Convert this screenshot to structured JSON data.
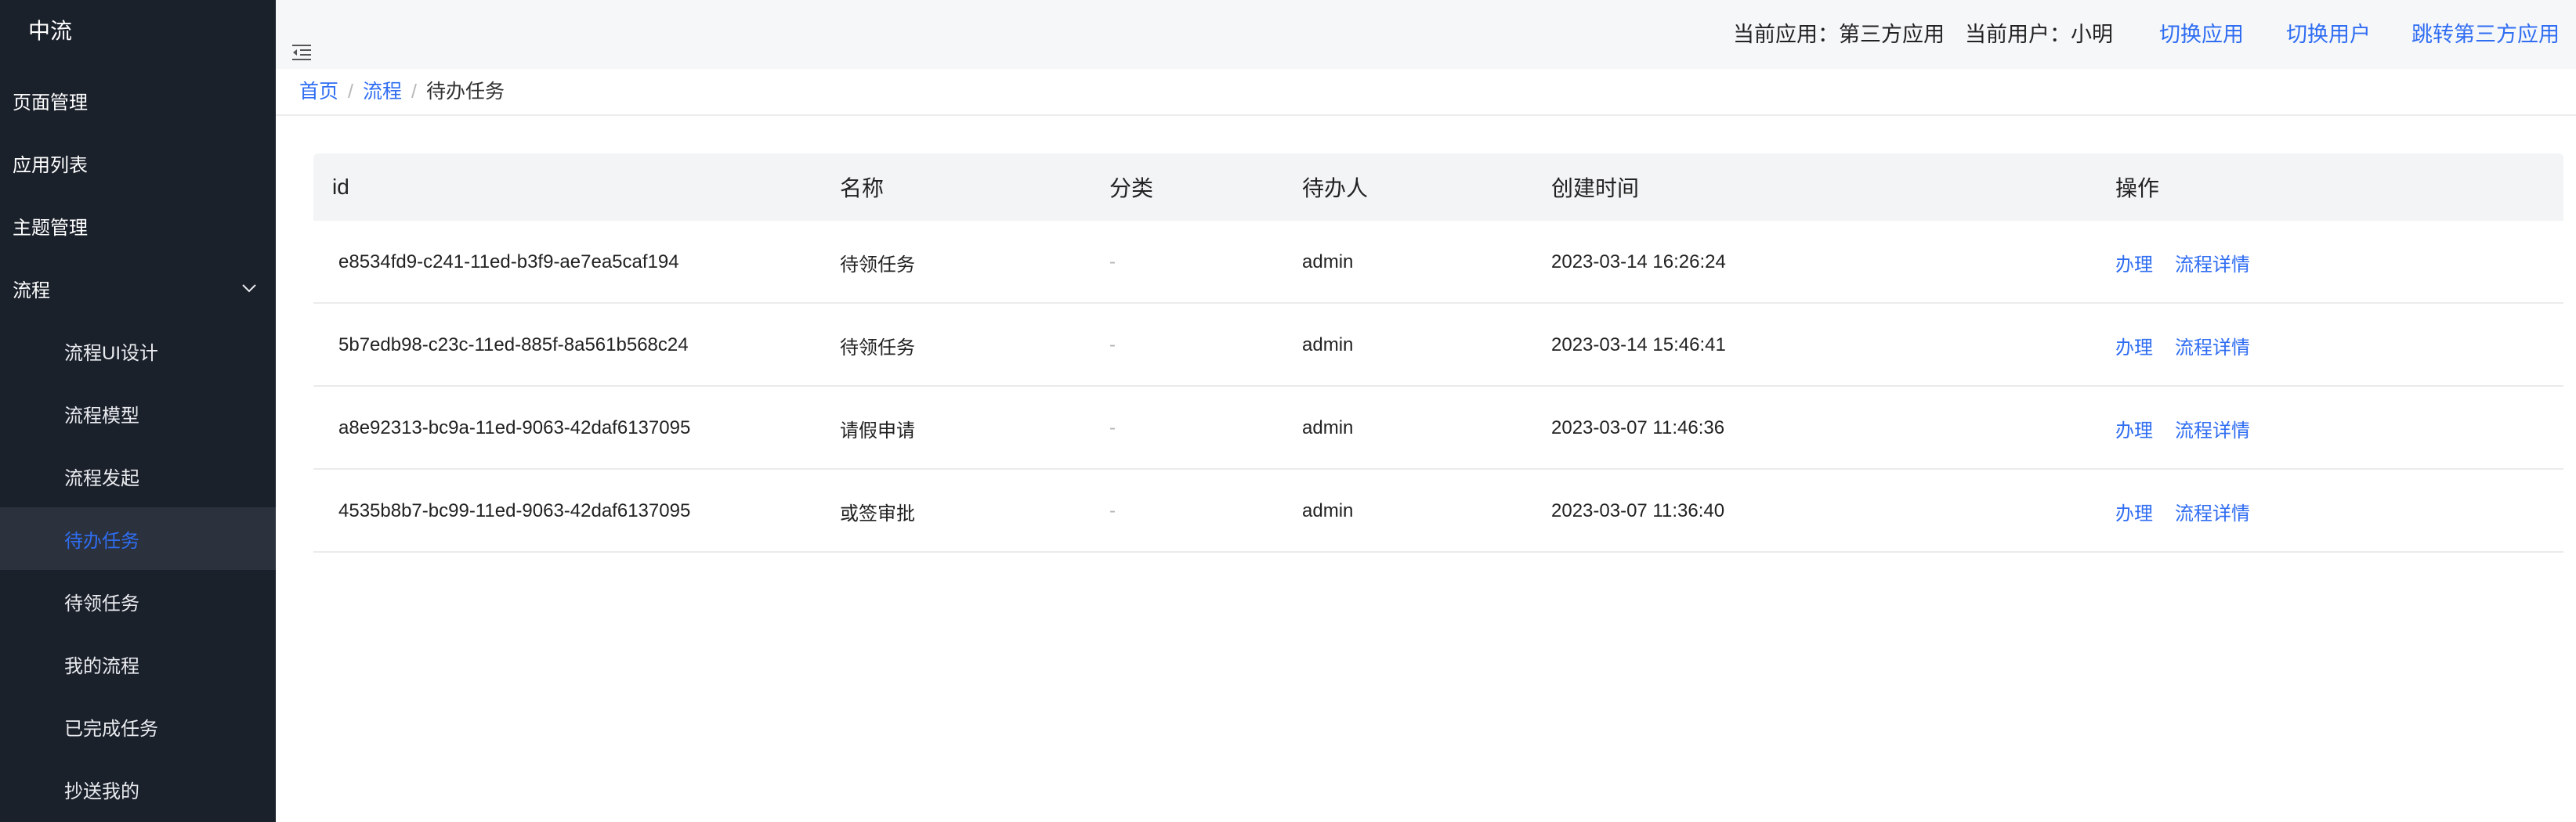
{
  "sidebar": {
    "brand": "中流",
    "items": [
      {
        "label": "页面管理"
      },
      {
        "label": "应用列表"
      },
      {
        "label": "主题管理"
      },
      {
        "label": "流程"
      }
    ],
    "flow_children": [
      {
        "label": "流程UI设计"
      },
      {
        "label": "流程模型"
      },
      {
        "label": "流程发起"
      },
      {
        "label": "待办任务"
      },
      {
        "label": "待领任务"
      },
      {
        "label": "我的流程"
      },
      {
        "label": "已完成任务"
      },
      {
        "label": "抄送我的"
      }
    ]
  },
  "header": {
    "current_app_label": "当前应用：",
    "current_app_value": "第三方应用",
    "current_user_label": "当前用户：",
    "current_user_value": "小明",
    "switch_app": "切换应用",
    "switch_user": "切换用户",
    "jump_third_party": "跳转第三方应用"
  },
  "breadcrumb": [
    {
      "label": "首页"
    },
    {
      "label": "流程"
    },
    {
      "label": "待办任务"
    }
  ],
  "breadcrumb_separator": "/",
  "table": {
    "columns": {
      "id": "id",
      "name": "名称",
      "category": "分类",
      "assignee": "待办人",
      "created": "创建时间",
      "ops": "操作"
    },
    "rows": [
      {
        "id": "e8534fd9-c241-11ed-b3f9-ae7ea5caf194",
        "name": "待领任务",
        "category": "-",
        "assignee": "admin",
        "created": "2023-03-14 16:26:24",
        "op_handle": "办理",
        "op_detail": "流程详情"
      },
      {
        "id": "5b7edb98-c23c-11ed-885f-8a561b568c24",
        "name": "待领任务",
        "category": "-",
        "assignee": "admin",
        "created": "2023-03-14 15:46:41",
        "op_handle": "办理",
        "op_detail": "流程详情"
      },
      {
        "id": "a8e92313-bc9a-11ed-9063-42daf6137095",
        "name": "请假申请",
        "category": "-",
        "assignee": "admin",
        "created": "2023-03-07 11:46:36",
        "op_handle": "办理",
        "op_detail": "流程详情"
      },
      {
        "id": "4535b8b7-bc99-11ed-9063-42daf6137095",
        "name": "或签审批",
        "category": "-",
        "assignee": "admin",
        "created": "2023-03-07 11:36:40",
        "op_handle": "办理",
        "op_detail": "流程详情"
      }
    ]
  },
  "colors": {
    "sidebar_bg": "#1b212b",
    "active_item_bg": "#2c323d",
    "accent": "#2f6df2"
  },
  "icons": {
    "fold": "menu-fold-icon",
    "expand": "chevron-down-icon"
  }
}
